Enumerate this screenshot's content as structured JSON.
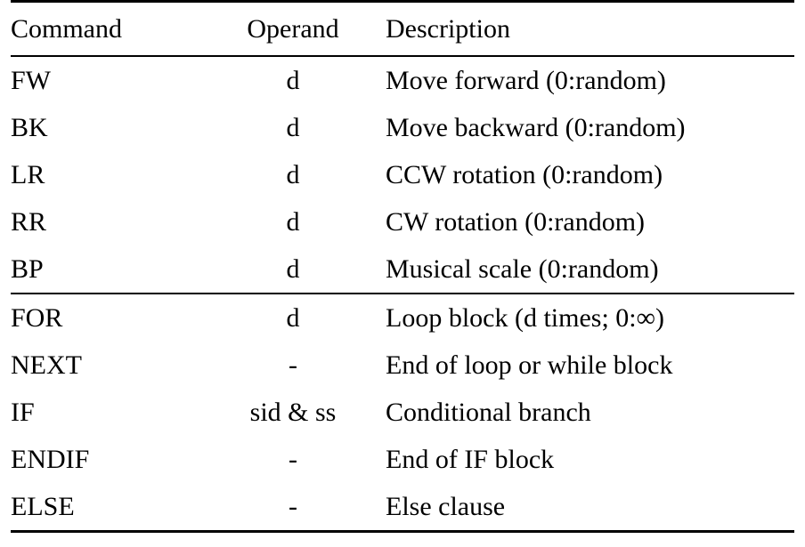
{
  "table": {
    "style": "booktabs",
    "rule_color": "#000000",
    "text_color": "#000000",
    "background_color": "#ffffff",
    "columns": [
      {
        "key": "command",
        "header": "Command",
        "align": "left"
      },
      {
        "key": "operand",
        "header": "Operand",
        "align": "center"
      },
      {
        "key": "description",
        "header": "Description",
        "align": "left"
      }
    ],
    "groups": [
      {
        "name": "motion-and-sound-commands",
        "rows": [
          {
            "command": "FW",
            "operand": "d",
            "description": "Move forward (0:random)"
          },
          {
            "command": "BK",
            "operand": "d",
            "description": "Move backward (0:random)"
          },
          {
            "command": "LR",
            "operand": "d",
            "description": "CCW rotation (0:random)"
          },
          {
            "command": "RR",
            "operand": "d",
            "description": "CW rotation (0:random)"
          },
          {
            "command": "BP",
            "operand": "d",
            "description": "Musical scale (0:random)"
          }
        ]
      },
      {
        "name": "control-flow-commands",
        "rows": [
          {
            "command": "FOR",
            "operand": "d",
            "description": "Loop block (d times; 0:∞)"
          },
          {
            "command": "NEXT",
            "operand": "-",
            "description": "End of loop or while block"
          },
          {
            "command": "IF",
            "operand": "sid & ss",
            "description": "Conditional branch"
          },
          {
            "command": "ENDIF",
            "operand": "-",
            "description": "End of IF block"
          },
          {
            "command": "ELSE",
            "operand": "-",
            "description": "Else clause"
          }
        ]
      }
    ]
  }
}
